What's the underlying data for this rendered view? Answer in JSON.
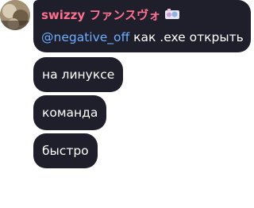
{
  "messages": [
    {
      "author": "swizzy ファンスヴォ",
      "mention": "@negative_off",
      "text": " как .exe открыть"
    },
    {
      "text": "на линуксе"
    },
    {
      "text": "команда"
    },
    {
      "text": "быстро"
    }
  ],
  "colors": {
    "bubble": "#1f1f2b",
    "author": "#ff6f8e",
    "mention": "#6eaeff"
  }
}
